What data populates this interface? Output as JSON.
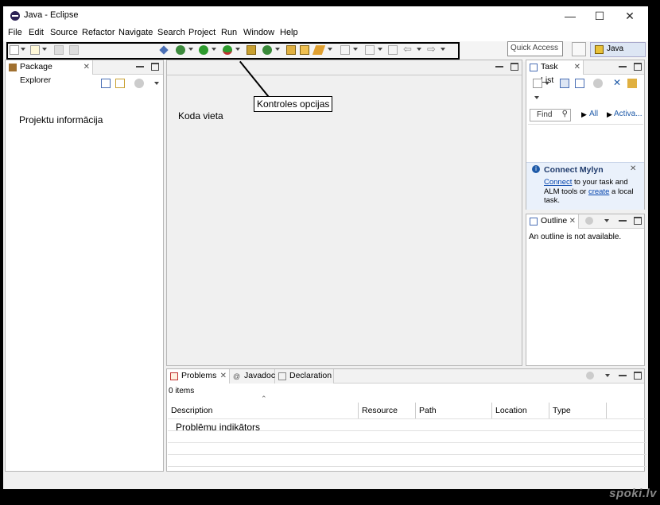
{
  "window": {
    "title": "Java - Eclipse",
    "minimize_label": "—",
    "maximize_label": "☐",
    "close_label": "✕"
  },
  "menu": {
    "items": [
      "File",
      "Edit",
      "Source",
      "Refactor",
      "Navigate",
      "Search",
      "Project",
      "Run",
      "Window",
      "Help"
    ]
  },
  "toolbar": {
    "quick_access_placeholder": "Quick Access",
    "perspective_label": "Java"
  },
  "package_explorer": {
    "tab_label": "Package Explorer",
    "annotation": "Projektu informācija"
  },
  "editor": {
    "annotation": "Koda vieta",
    "callout": "Kontroles opcijas"
  },
  "task_list": {
    "tab_label": "Task List",
    "find_placeholder": "Find",
    "filter_all": "All",
    "filter_activate": "Activa..."
  },
  "mylyn": {
    "title": "Connect Mylyn",
    "connect_link": "Connect",
    "text1": "to your task and",
    "text2": "ALM tools or",
    "create_link": "create",
    "text3": "a local",
    "text4": "task."
  },
  "outline": {
    "tab_label": "Outline",
    "message": "An outline is not available."
  },
  "bottom": {
    "tabs": {
      "problems": "Problems",
      "javadoc": "Javadoc",
      "declaration": "Declaration"
    },
    "items_count": "0 items",
    "columns": [
      "Description",
      "Resource",
      "Path",
      "Location",
      "Type"
    ],
    "annotation": "Problēmu indikātors"
  },
  "watermark": "spoki.lv",
  "colors": {
    "accent": "#1e5aa8",
    "selection": "#dde6f4",
    "border": "#b7b7b7"
  }
}
